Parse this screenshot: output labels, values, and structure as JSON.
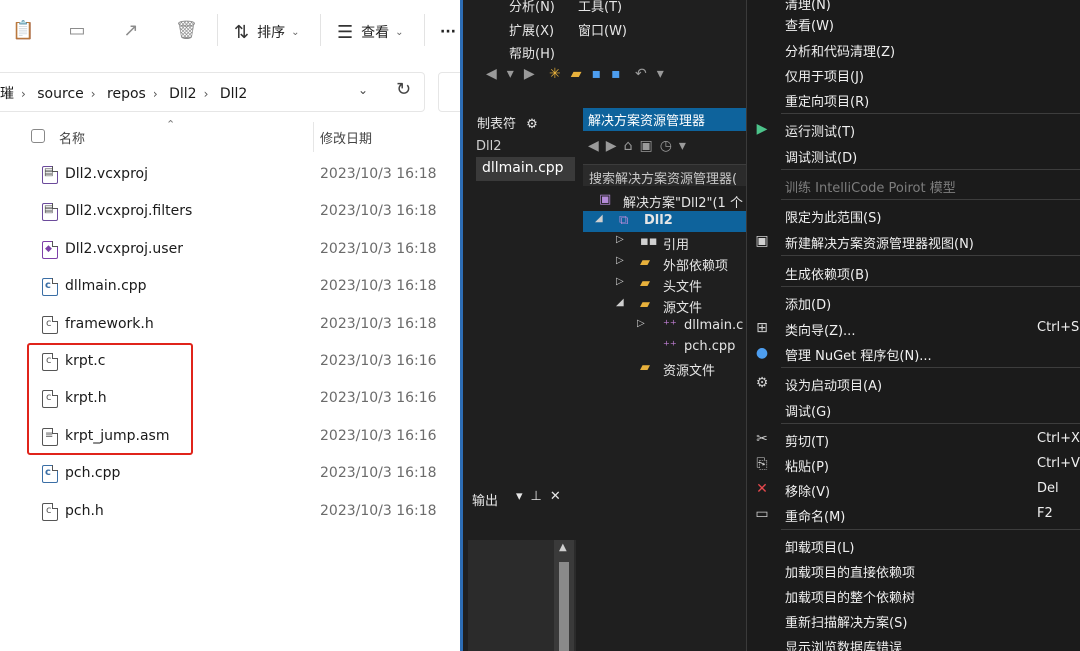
{
  "explorer": {
    "toolbar": {
      "sort_label": "排序",
      "view_label": "查看",
      "more_label": "···"
    },
    "breadcrumb": [
      "璀",
      "source",
      "repos",
      "Dll2",
      "Dll2"
    ],
    "columns": {
      "name": "名称",
      "modified": "修改日期"
    },
    "files": [
      {
        "name": "Dll2.vcxproj",
        "date": "2023/10/3 16:18",
        "icon": "proj"
      },
      {
        "name": "Dll2.vcxproj.filters",
        "date": "2023/10/3 16:18",
        "icon": "proj"
      },
      {
        "name": "Dll2.vcxproj.user",
        "date": "2023/10/3 16:18",
        "icon": "user"
      },
      {
        "name": "dllmain.cpp",
        "date": "2023/10/3 16:18",
        "icon": "cpp"
      },
      {
        "name": "framework.h",
        "date": "2023/10/3 16:18",
        "icon": "h"
      },
      {
        "name": "krpt.c",
        "date": "2023/10/3 16:16",
        "icon": "h"
      },
      {
        "name": "krpt.h",
        "date": "2023/10/3 16:16",
        "icon": "h"
      },
      {
        "name": "krpt_jump.asm",
        "date": "2023/10/3 16:16",
        "icon": "asm"
      },
      {
        "name": "pch.cpp",
        "date": "2023/10/3 16:18",
        "icon": "cpp"
      },
      {
        "name": "pch.h",
        "date": "2023/10/3 16:18",
        "icon": "h"
      }
    ],
    "highlight_color": "#e0241b"
  },
  "vs": {
    "menu": {
      "analyze": "分析(N)",
      "tools": "工具(T)",
      "extensions": "扩展(X)",
      "window": "窗口(W)",
      "help": "帮助(H)"
    },
    "props_tab": "制表符",
    "project_label": "Dll2",
    "open_file_tab": "dllmain.cpp",
    "solution_explorer_title": "解决方案资源管理器",
    "solution_search": "搜索解决方案资源管理器(",
    "tree": {
      "solution": "解决方案\"Dll2\"(1 个",
      "project": "Dll2",
      "references": "引用",
      "external_deps": "外部依赖项",
      "header_files": "头文件",
      "source_files": "源文件",
      "dllmain": "dllmain.c",
      "pch": "pch.cpp",
      "resource_files": "资源文件"
    },
    "output_title": "输出",
    "accent_color": "#0e639c"
  },
  "context_menu": {
    "items": [
      {
        "label": "清理(N)",
        "shortcut": ""
      },
      {
        "label": "查看(W)",
        "shortcut": ""
      },
      {
        "label": "分析和代码清理(Z)",
        "shortcut": ""
      },
      {
        "label": "仅用于项目(J)",
        "shortcut": ""
      },
      {
        "label": "重定向项目(R)",
        "shortcut": ""
      },
      {
        "label": "运行测试(T)",
        "shortcut": ""
      },
      {
        "label": "调试测试(D)",
        "shortcut": ""
      },
      {
        "label": "训练 IntelliCode Poirot 模型",
        "shortcut": ""
      },
      {
        "label": "限定为此范围(S)",
        "shortcut": ""
      },
      {
        "label": "新建解决方案资源管理器视图(N)",
        "shortcut": ""
      },
      {
        "label": "生成依赖项(B)",
        "shortcut": ""
      },
      {
        "label": "添加(D)",
        "shortcut": ""
      },
      {
        "label": "类向导(Z)...",
        "shortcut": "Ctrl+Sh"
      },
      {
        "label": "管理 NuGet 程序包(N)...",
        "shortcut": ""
      },
      {
        "label": "设为启动项目(A)",
        "shortcut": ""
      },
      {
        "label": "调试(G)",
        "shortcut": ""
      },
      {
        "label": "剪切(T)",
        "shortcut": "Ctrl+X"
      },
      {
        "label": "粘贴(P)",
        "shortcut": "Ctrl+V"
      },
      {
        "label": "移除(V)",
        "shortcut": "Del"
      },
      {
        "label": "重命名(M)",
        "shortcut": "F2"
      },
      {
        "label": "卸载项目(L)",
        "shortcut": ""
      },
      {
        "label": "加载项目的直接依赖项",
        "shortcut": ""
      },
      {
        "label": "加载项目的整个依赖树",
        "shortcut": ""
      },
      {
        "label": "重新扫描解决方案(S)",
        "shortcut": ""
      },
      {
        "label": "显示浏览数据库错误",
        "shortcut": ""
      }
    ]
  }
}
